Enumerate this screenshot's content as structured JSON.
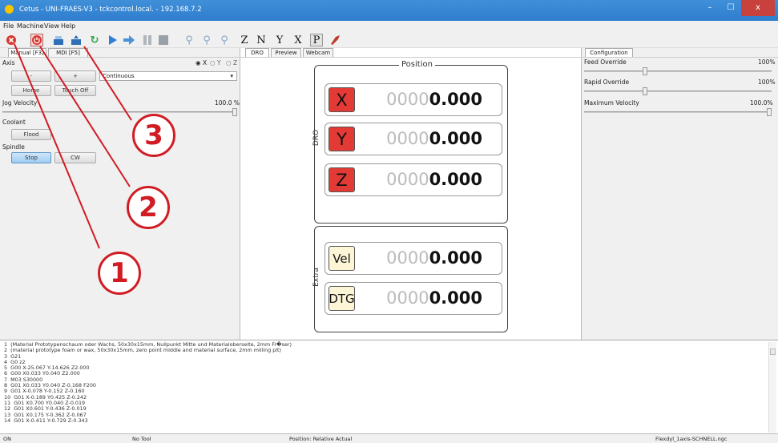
{
  "window": {
    "title": "Cetus - UNI-FRAES-V3 - tckcontrol.local. - 192.168.7.2",
    "min": "–",
    "max": "☐",
    "close": "x"
  },
  "menu": [
    "File",
    "Machine",
    "View",
    "Help"
  ],
  "toolbar": {
    "z_label": "Z",
    "n_label": "N",
    "y_label": "Y",
    "x_label": "X",
    "p_label": "P"
  },
  "left": {
    "tabs": [
      "Manual [F3]",
      "MDI [F5]"
    ],
    "axis_label": "Axis",
    "axis_options": [
      "X",
      "Y",
      "Z"
    ],
    "minus_label": "-",
    "plus_label": "+",
    "jog_mode": "Continuous",
    "home_label": "Home",
    "touch_off_label": "Touch Off",
    "jog_velocity_label": "Jog Velocity",
    "jog_velocity_value": "100.0 %",
    "jog_velocity_level": 1.0,
    "coolant_label": "Coolant",
    "flood_label": "Flood",
    "spindle_label": "Spindle",
    "stop_label": "Stop",
    "cw_label": "CW"
  },
  "center": {
    "tabs": [
      "DRO",
      "Preview",
      "Webcam"
    ],
    "position_title": "Position",
    "dro_label": "DRO",
    "extra_label": "Extra",
    "axes": [
      {
        "name": "X",
        "dim": "0000",
        "bold": "0.000"
      },
      {
        "name": "Y",
        "dim": "0000",
        "bold": "0.000"
      },
      {
        "name": "Z",
        "dim": "0000",
        "bold": "0.000"
      }
    ],
    "extras": [
      {
        "name": "Vel",
        "dim": "0000",
        "bold": "0.000"
      },
      {
        "name": "DTG",
        "dim": "0000",
        "bold": "0.000"
      }
    ]
  },
  "right": {
    "tab": "Configuration",
    "feed_label": "Feed Override",
    "feed_value": "100%",
    "feed_level": 0.32,
    "rapid_label": "Rapid Override",
    "rapid_value": "100%",
    "rapid_level": 0.32,
    "maxvel_label": "Maximum Velocity",
    "maxvel_value": "100.0%",
    "maxvel_level": 1.0
  },
  "gcode": [
    "1  (Material Prototypenschaum oder Wachs, 50x30x15mm, Nullpunkt Mitte und Materialoberseite, 2mm Fr�ser)",
    "2  (material prototype foam or wax, 50x30x15mm, zero point middle and material surface, 2mm milling pit)",
    "3  G21",
    "4  G0 z2",
    "5  G00 X-25.067 Y-14.626 Z2.000",
    "6  G00 X0.033 Y0.040 Z2.000",
    "7  M03 S30000",
    "8  G01 X0.033 Y0.040 Z-0.168 F200",
    "9  G01 X-0.078 Y-0.152 Z-0.160",
    "10  G01 X-0.189 Y0.425 Z-0.242",
    "11  G01 X0.700 Y0.040 Z-0.019",
    "12  G01 X0.601 Y-0.436 Z-0.019",
    "13  G01 X0.175 Y-0.362 Z-0.067",
    "14  G01 X-0.411 Y-0.729 Z-0.343"
  ],
  "status": {
    "state": "ON",
    "tool": "No Tool",
    "position": "Position: Relative Actual",
    "file": "Flexdyl_1axis-SCHNELL.ngc"
  },
  "callouts": [
    "1",
    "2",
    "3"
  ]
}
